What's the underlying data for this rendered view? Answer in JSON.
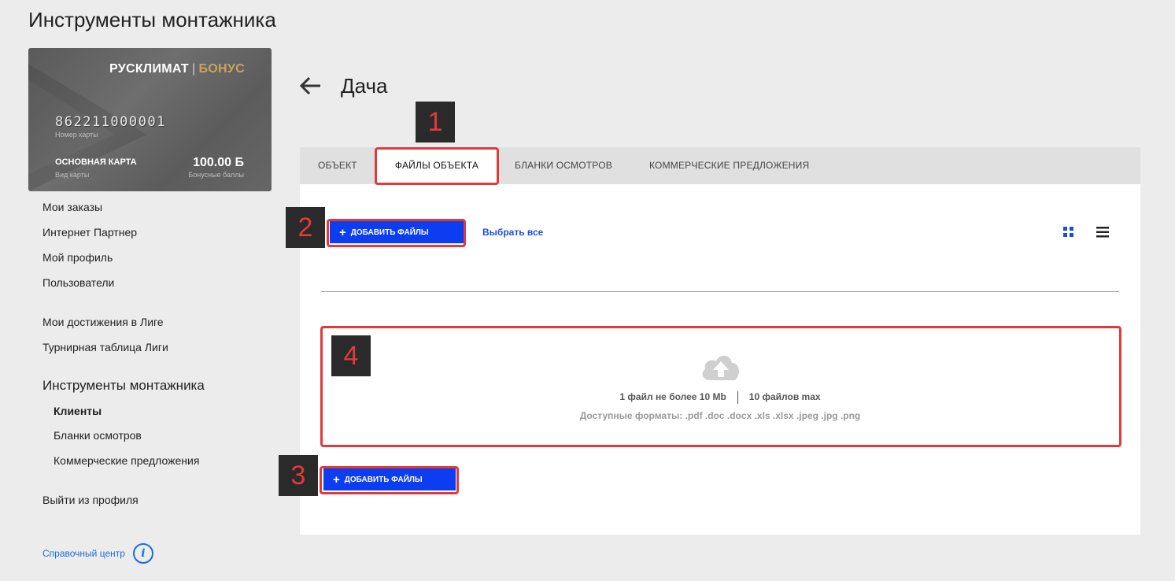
{
  "page": {
    "title": "Инструменты монтажника"
  },
  "card": {
    "brand_main": "РУСКЛИМАТ",
    "brand_sep": "|",
    "brand_accent": "БОНУС",
    "number": "862211000001",
    "number_label": "Номер карты",
    "type": "ОСНОВНАЯ КАРТА",
    "type_label": "Вид карты",
    "points": "100.00 Б",
    "points_label": "Бонусные баллы"
  },
  "sidebar": {
    "items": [
      {
        "label": "Мои заказы"
      },
      {
        "label": "Интернет Партнер"
      },
      {
        "label": "Мой профиль"
      },
      {
        "label": "Пользователи"
      },
      {
        "label": "Мои достижения в Лиге"
      },
      {
        "label": "Турнирная таблица Лиги"
      }
    ],
    "section_title": "Инструменты монтажника",
    "sub_items": [
      {
        "label": "Клиенты",
        "active": true
      },
      {
        "label": "Бланки осмотров"
      },
      {
        "label": "Коммерческие предложения"
      }
    ],
    "logout": "Выйти из профиля",
    "help_label": "Справочный центр",
    "help_icon": "i"
  },
  "header": {
    "object_title": "Дача",
    "back_icon": "arrow-left-icon"
  },
  "tabs": [
    {
      "label": "ОБЪЕКТ"
    },
    {
      "label": "ФАЙЛЫ ОБЪЕКТА",
      "active": true
    },
    {
      "label": "БЛАНКИ ОСМОТРОВ"
    },
    {
      "label": "КОММЕРЧЕСКИЕ ПРЕДЛОЖЕНИЯ"
    }
  ],
  "files": {
    "add_label": "ДОБАВИТЬ ФАЙЛЫ",
    "add_icon": "+",
    "select_all": "Выбрать все",
    "view_grid_icon": "grid-view-icon",
    "view_list_icon": "list-view-icon",
    "upload_icon": "cloud-upload-icon",
    "limit_size": "1 файл не более 10 Mb",
    "limit_count": "10 файлов max",
    "formats": "Доступные форматы: .pdf .doc .docx .xls .xlsx .jpeg .jpg .png"
  },
  "annotations": [
    "1",
    "2",
    "3",
    "4"
  ],
  "colors": {
    "accent_blue": "#0c3df0",
    "link_blue": "#1a4fd6",
    "highlight_red": "#e03a3a",
    "card_gold": "#c9a45a"
  }
}
